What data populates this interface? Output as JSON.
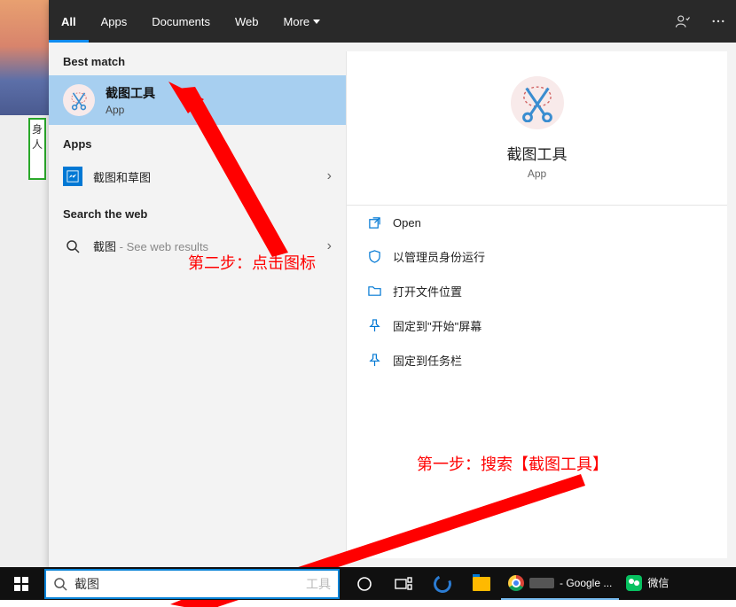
{
  "tabs": {
    "all": "All",
    "apps": "Apps",
    "documents": "Documents",
    "web": "Web",
    "more": "More"
  },
  "sections": {
    "best_match": "Best match",
    "apps": "Apps",
    "search_web": "Search the web"
  },
  "best_match": {
    "title": "截图工具",
    "subtitle": "App"
  },
  "app_results": [
    {
      "label": "截图和草图"
    }
  ],
  "web_result": {
    "query": "截图",
    "suffix": " - See web results"
  },
  "preview": {
    "title": "截图工具",
    "subtitle": "App",
    "actions": {
      "open": "Open",
      "run_as_admin": "以管理员身份运行",
      "open_file_location": "打开文件位置",
      "pin_to_start": "固定到\"开始\"屏幕",
      "pin_to_taskbar": "固定到任务栏"
    }
  },
  "annotations": {
    "step2": "第二步：点击图标",
    "step1": "第一步：搜索【截图工具】"
  },
  "searchbox": {
    "value": "截图",
    "placeholder": "工具"
  },
  "taskbar": {
    "chrome_task": "- Google ...",
    "wechat": "微信"
  },
  "colors": {
    "accent": "#0078d4",
    "annotation": "#ff0000",
    "selected": "#a7cff0",
    "taskbar": "#101010"
  }
}
